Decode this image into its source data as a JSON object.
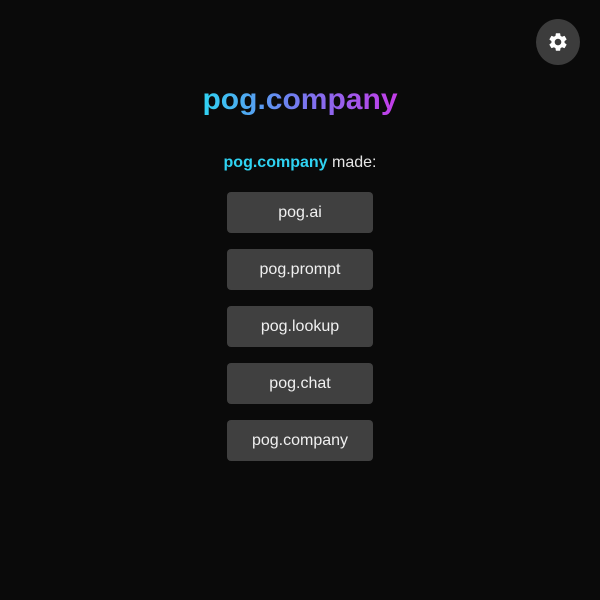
{
  "header": {
    "settings_icon": "gear-icon"
  },
  "brand": {
    "title": "pog.company",
    "gradient_colors": [
      "#2fd3f2",
      "#6f7ff0",
      "#c53be8"
    ]
  },
  "made": {
    "brand": "pog.company",
    "text": "made:",
    "brand_color": "#2fd3f2"
  },
  "products": [
    {
      "label": "pog.ai"
    },
    {
      "label": "pog.prompt"
    },
    {
      "label": "pog.lookup"
    },
    {
      "label": "pog.chat"
    },
    {
      "label": "pog.company"
    }
  ]
}
